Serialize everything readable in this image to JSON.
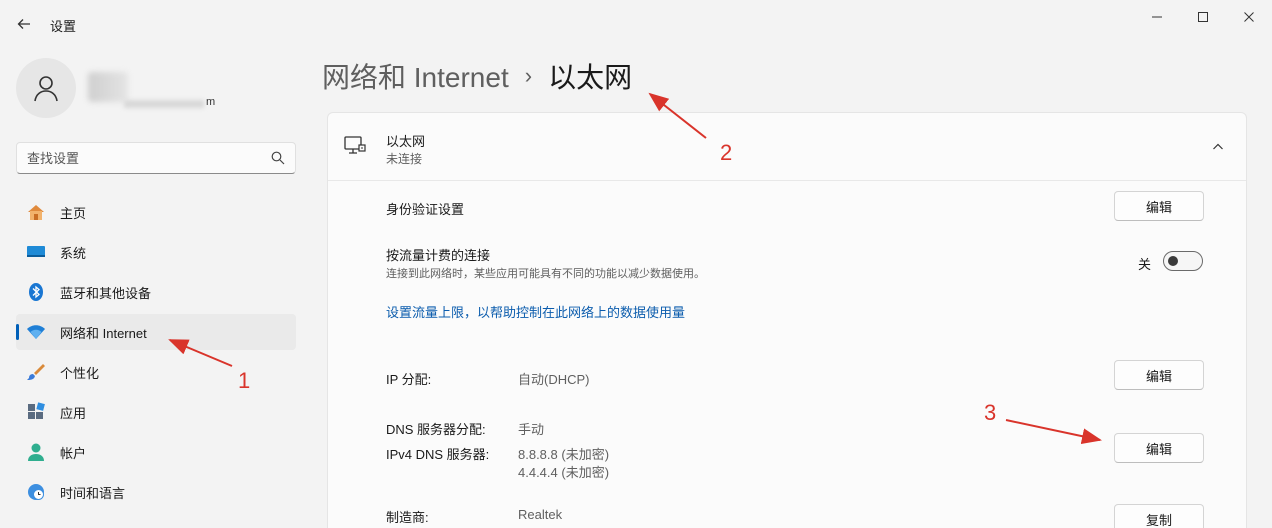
{
  "window": {
    "title": "设置"
  },
  "profile": {
    "name_tail": "m"
  },
  "search": {
    "placeholder": "查找设置"
  },
  "sidebar": {
    "items": [
      {
        "label": "主页",
        "icon": "home-icon"
      },
      {
        "label": "系统",
        "icon": "system-icon"
      },
      {
        "label": "蓝牙和其他设备",
        "icon": "bluetooth-icon"
      },
      {
        "label": "网络和 Internet",
        "icon": "wifi-icon",
        "active": true
      },
      {
        "label": "个性化",
        "icon": "brush-icon"
      },
      {
        "label": "应用",
        "icon": "apps-icon"
      },
      {
        "label": "帐户",
        "icon": "account-icon"
      },
      {
        "label": "时间和语言",
        "icon": "clock-globe-icon"
      }
    ]
  },
  "breadcrumb": {
    "parent": "网络和 Internet",
    "separator": "›",
    "current": "以太网"
  },
  "ethernet": {
    "title": "以太网",
    "status": "未连接",
    "auth": {
      "label": "身份验证设置",
      "button": "编辑"
    },
    "metered": {
      "label": "按流量计费的连接",
      "desc": "连接到此网络时，某些应用可能具有不同的功能以减少数据使用。",
      "state": "关"
    },
    "data_limit_link": "设置流量上限，以帮助控制在此网络上的数据使用量",
    "ip": {
      "label": "IP 分配:",
      "value": "自动(DHCP)",
      "button": "编辑"
    },
    "dns": {
      "label": "DNS 服务器分配:",
      "value": "手动",
      "ipv4_label": "IPv4 DNS 服务器:",
      "ipv4_1": "8.8.8.8 (未加密)",
      "ipv4_2": "4.4.4.4 (未加密)",
      "button": "编辑"
    },
    "manufacturer": {
      "label": "制造商:",
      "value": "Realtek",
      "button": "复制"
    }
  },
  "annotations": {
    "one": "1",
    "two": "2",
    "three": "3"
  },
  "colors": {
    "accent": "#005fb8",
    "link": "#0b5cad",
    "annotation": "#d9342b"
  }
}
